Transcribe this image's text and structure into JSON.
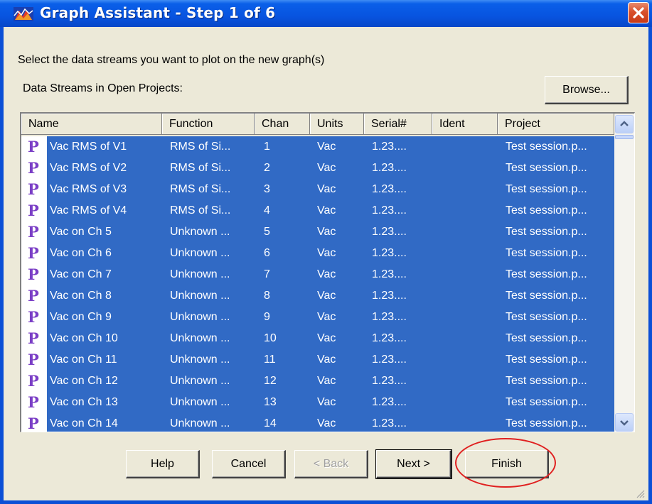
{
  "window": {
    "title": "Graph Assistant - Step 1 of 6",
    "close_symbol": "✕"
  },
  "instruction": "Select the data streams you want to plot on the new graph(s)",
  "streams_label": "Data Streams in Open Projects:",
  "browse_label": "Browse...",
  "columns": [
    "Name",
    "Function",
    "Chan",
    "Units",
    "Serial#",
    "Ident",
    "Project"
  ],
  "rows": [
    {
      "icon": "P",
      "name": "Vac RMS of V1",
      "function": "RMS of Si...",
      "chan": "1",
      "units": "Vac",
      "serial": "1.23....",
      "ident": "",
      "project": "Test session.p..."
    },
    {
      "icon": "P",
      "name": "Vac RMS of V2",
      "function": "RMS of Si...",
      "chan": "2",
      "units": "Vac",
      "serial": "1.23....",
      "ident": "",
      "project": "Test session.p..."
    },
    {
      "icon": "P",
      "name": "Vac RMS of V3",
      "function": "RMS of Si...",
      "chan": "3",
      "units": "Vac",
      "serial": "1.23....",
      "ident": "",
      "project": "Test session.p..."
    },
    {
      "icon": "P",
      "name": "Vac RMS of V4",
      "function": "RMS of Si...",
      "chan": "4",
      "units": "Vac",
      "serial": "1.23....",
      "ident": "",
      "project": "Test session.p..."
    },
    {
      "icon": "P",
      "name": "Vac on Ch 5",
      "function": "Unknown ...",
      "chan": "5",
      "units": "Vac",
      "serial": "1.23....",
      "ident": "",
      "project": "Test session.p..."
    },
    {
      "icon": "P",
      "name": "Vac on Ch 6",
      "function": "Unknown ...",
      "chan": "6",
      "units": "Vac",
      "serial": "1.23....",
      "ident": "",
      "project": "Test session.p..."
    },
    {
      "icon": "P",
      "name": "Vac on Ch 7",
      "function": "Unknown ...",
      "chan": "7",
      "units": "Vac",
      "serial": "1.23....",
      "ident": "",
      "project": "Test session.p..."
    },
    {
      "icon": "P",
      "name": "Vac on Ch 8",
      "function": "Unknown ...",
      "chan": "8",
      "units": "Vac",
      "serial": "1.23....",
      "ident": "",
      "project": "Test session.p..."
    },
    {
      "icon": "P",
      "name": "Vac on Ch 9",
      "function": "Unknown ...",
      "chan": "9",
      "units": "Vac",
      "serial": "1.23....",
      "ident": "",
      "project": "Test session.p..."
    },
    {
      "icon": "P",
      "name": "Vac on Ch 10",
      "function": "Unknown ...",
      "chan": "10",
      "units": "Vac",
      "serial": "1.23....",
      "ident": "",
      "project": "Test session.p..."
    },
    {
      "icon": "P",
      "name": "Vac on Ch 11",
      "function": "Unknown ...",
      "chan": "11",
      "units": "Vac",
      "serial": "1.23....",
      "ident": "",
      "project": "Test session.p..."
    },
    {
      "icon": "P",
      "name": "Vac on Ch 12",
      "function": "Unknown ...",
      "chan": "12",
      "units": "Vac",
      "serial": "1.23....",
      "ident": "",
      "project": "Test session.p..."
    },
    {
      "icon": "P",
      "name": "Vac on Ch 13",
      "function": "Unknown ...",
      "chan": "13",
      "units": "Vac",
      "serial": "1.23....",
      "ident": "",
      "project": "Test session.p..."
    },
    {
      "icon": "P",
      "name": "Vac on Ch 14",
      "function": "Unknown ...",
      "chan": "14",
      "units": "Vac",
      "serial": "1.23....",
      "ident": "",
      "project": "Test session.p..."
    }
  ],
  "buttons": {
    "help": "Help",
    "cancel": "Cancel",
    "back": "< Back",
    "next": "Next >",
    "finish": "Finish"
  },
  "colors": {
    "selection": "#316ac5",
    "title_bar": "#0a5fe8",
    "annotation": "#e02020",
    "p_icon": "#7b3fc6"
  }
}
